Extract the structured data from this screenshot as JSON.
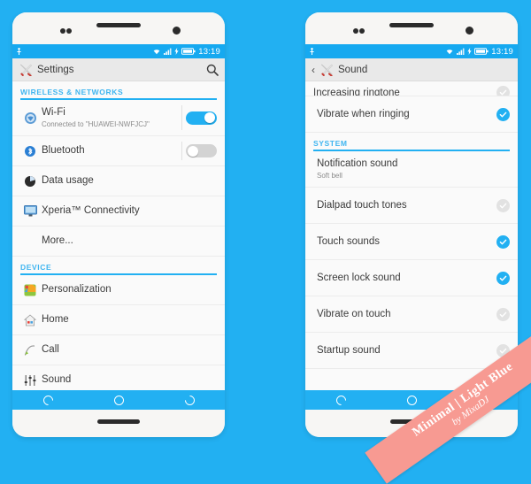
{
  "background_color": "#22b0f2",
  "accent_color": "#22b0f2",
  "status_bar": {
    "time": "13:19",
    "icons": [
      "usb-icon",
      "wifi-icon",
      "signal-icon",
      "charging-bolt-icon",
      "battery-icon"
    ]
  },
  "phone_left": {
    "header": {
      "title": "Settings",
      "icon": "tools-icon",
      "search": "search-icon"
    },
    "sections": [
      {
        "title": "WIRELESS & NETWORKS",
        "rows": [
          {
            "label": "Wi-Fi",
            "sub": "Connected to \"HUAWEI-NWFJCJ\"",
            "icon": "wifi-globe-icon",
            "control": "toggle",
            "state": "on"
          },
          {
            "label": "Bluetooth",
            "sub": "",
            "icon": "bluetooth-icon",
            "control": "toggle",
            "state": "off"
          },
          {
            "label": "Data usage",
            "sub": "",
            "icon": "data-usage-icon",
            "control": "none",
            "state": ""
          },
          {
            "label": "Xperia™ Connectivity",
            "sub": "",
            "icon": "xperia-connectivity-icon",
            "control": "none",
            "state": ""
          },
          {
            "label": "More...",
            "sub": "",
            "icon": "none",
            "control": "none",
            "state": ""
          }
        ]
      },
      {
        "title": "DEVICE",
        "rows": [
          {
            "label": "Personalization",
            "sub": "",
            "icon": "personalization-icon",
            "control": "none",
            "state": ""
          },
          {
            "label": "Home",
            "sub": "",
            "icon": "home-icon",
            "control": "none",
            "state": ""
          },
          {
            "label": "Call",
            "sub": "",
            "icon": "call-icon",
            "control": "none",
            "state": ""
          },
          {
            "label": "Sound",
            "sub": "",
            "icon": "sound-sliders-icon",
            "control": "none",
            "state": ""
          }
        ]
      }
    ]
  },
  "phone_right": {
    "header": {
      "title": "Sound",
      "icon": "tools-icon",
      "back": "back-chevron-icon"
    },
    "clipped_row": {
      "label": "Increasing ringtone",
      "control": "check",
      "state": "off"
    },
    "rows_top": [
      {
        "label": "Vibrate when ringing",
        "sub": "",
        "control": "check",
        "state": "on"
      }
    ],
    "sections": [
      {
        "title": "SYSTEM",
        "rows": [
          {
            "label": "Notification sound",
            "sub": "Soft bell",
            "control": "none",
            "state": ""
          },
          {
            "label": "Dialpad touch tones",
            "sub": "",
            "control": "check",
            "state": "off"
          },
          {
            "label": "Touch sounds",
            "sub": "",
            "control": "check",
            "state": "on"
          },
          {
            "label": "Screen lock sound",
            "sub": "",
            "control": "check",
            "state": "on"
          },
          {
            "label": "Vibrate on touch",
            "sub": "",
            "control": "check",
            "state": "off"
          },
          {
            "label": "Startup sound",
            "sub": "",
            "control": "check",
            "state": "off"
          }
        ]
      }
    ]
  },
  "nav_bar": {
    "buttons": [
      "back-circle-icon",
      "home-circle-icon",
      "recents-circle-icon"
    ]
  },
  "ribbon": {
    "line1": "Minimal | Light Blue",
    "line2": "by MixaDJ",
    "color": "#f79a92"
  }
}
